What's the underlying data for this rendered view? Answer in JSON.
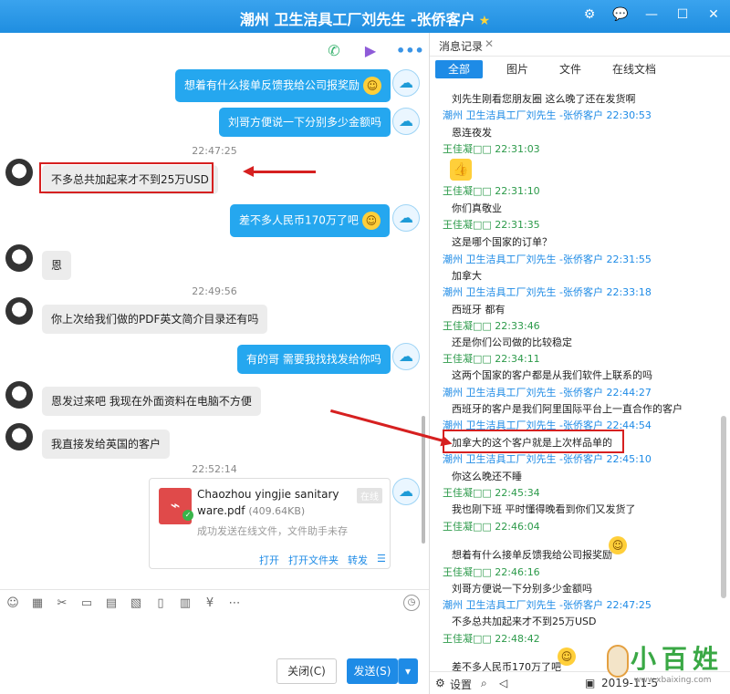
{
  "window": {
    "title": "潮州 卫生洁具工厂刘先生 -张侨客户",
    "btn_settings": "⚙",
    "btn_chat": "💬",
    "btn_min": "—",
    "btn_max": "☐",
    "btn_close": "✕"
  },
  "chat": {
    "ts1": "22:47:25",
    "ts2": "22:49:56",
    "ts3": "22:52:14",
    "msg_out_1": "想着有什么接单反馈我给公司报奖励",
    "msg_out_2": "刘哥方便说一下分别多少金额吗",
    "msg_in_1": "不多总共加起来才不到25万USD",
    "msg_out_3": "差不多人民币170万了吧",
    "msg_in_2": "恩",
    "msg_in_3": "你上次给我们做的PDF英文简介目录还有吗",
    "msg_out_4": "有的哥 需要我找找发给你吗",
    "msg_in_4": "恩发过来吧  我现在外面资料在电脑不方便",
    "msg_in_5": "我直接发给英国的客户",
    "file": {
      "name": "Chaozhou yingjie sanitary ware.pdf",
      "size": "(409.64KB)",
      "badge": "在线",
      "status": "成功发送在线文件，文件助手未存",
      "open": "打开",
      "open_folder": "打开文件夹",
      "forward": "转发",
      "menu": "☰"
    }
  },
  "input": {
    "close_label": "关闭(C)",
    "send_label": "发送(S)",
    "send_dropdown": "▾"
  },
  "history": {
    "title": "消息记录",
    "close": "✕",
    "tabs": [
      "全部",
      "图片",
      "文件",
      "在线文档"
    ],
    "lines": [
      {
        "kind": "msg",
        "text": "刘先生刚看您朋友圈 这么晚了还在发货啊"
      },
      {
        "kind": "head-cust",
        "text": "潮州 卫生洁具工厂刘先生 -张侨客户 22:30:53"
      },
      {
        "kind": "msg",
        "text": "恩连夜发"
      },
      {
        "kind": "head-me",
        "text": "王佳凝□□ 22:31:03"
      },
      {
        "kind": "head-me",
        "text": "王佳凝□□ 22:31:10"
      },
      {
        "kind": "msg",
        "text": "你们真敬业"
      },
      {
        "kind": "head-me",
        "text": "王佳凝□□ 22:31:35"
      },
      {
        "kind": "msg",
        "text": "这是哪个国家的订单？"
      },
      {
        "kind": "head-cust",
        "text": "潮州 卫生洁具工厂刘先生 -张侨客户 22:31:55"
      },
      {
        "kind": "msg",
        "text": "加拿大"
      },
      {
        "kind": "head-cust",
        "text": "潮州 卫生洁具工厂刘先生 -张侨客户 22:33:18"
      },
      {
        "kind": "msg",
        "text": "西班牙 都有"
      },
      {
        "kind": "head-me",
        "text": "王佳凝□□ 22:33:46"
      },
      {
        "kind": "msg",
        "text": "还是你们公司做的比较稳定"
      },
      {
        "kind": "head-me",
        "text": "王佳凝□□ 22:34:11"
      },
      {
        "kind": "msg",
        "text": "这两个国家的客户都是从我们软件上联系的吗"
      },
      {
        "kind": "head-cust",
        "text": "潮州 卫生洁具工厂刘先生 -张侨客户 22:44:27"
      },
      {
        "kind": "msg",
        "text": "西班牙的客户是我们阿里国际平台上一直合作的客户"
      },
      {
        "kind": "head-cust",
        "text": "潮州 卫生洁具工厂刘先生 -张侨客户 22:44:54"
      },
      {
        "kind": "msg",
        "text": "加拿大的这个客户就是上次样品单的"
      },
      {
        "kind": "head-cust",
        "text": "潮州 卫生洁具工厂刘先生 -张侨客户 22:45:10"
      },
      {
        "kind": "msg",
        "text": "你这么晚还不睡"
      },
      {
        "kind": "head-me",
        "text": "王佳凝□□ 22:45:34"
      },
      {
        "kind": "msg",
        "text": "我也刚下班 平时懂得晚看到你们又发货了"
      },
      {
        "kind": "head-me",
        "text": "王佳凝□□ 22:46:04"
      },
      {
        "kind": "msg",
        "text": "想着有什么接单反馈我给公司报奖励"
      },
      {
        "kind": "head-me",
        "text": "王佳凝□□ 22:46:16"
      },
      {
        "kind": "msg",
        "text": "刘哥方便说一下分别多少金额吗"
      },
      {
        "kind": "head-cust",
        "text": "潮州 卫生洁具工厂刘先生 -张侨客户 22:47:25"
      },
      {
        "kind": "msg",
        "text": "不多总共加起来才不到25万USD"
      },
      {
        "kind": "head-me",
        "text": "王佳凝□□ 22:48:42"
      },
      {
        "kind": "msg",
        "text": "差不多人民币170万了吧"
      }
    ],
    "footer": {
      "settings": "设置",
      "date": "2019-11-5"
    },
    "watermark": {
      "chars": "小百姓",
      "url": "www.xbaixing.com"
    }
  },
  "colors": {
    "title_bar": "#1f8ee0",
    "out_bubble": "#25a7ef",
    "in_bubble": "#ececec",
    "highlight": "#d62020",
    "customer_name": "#1e8be6",
    "my_name": "#2c9a4a"
  }
}
